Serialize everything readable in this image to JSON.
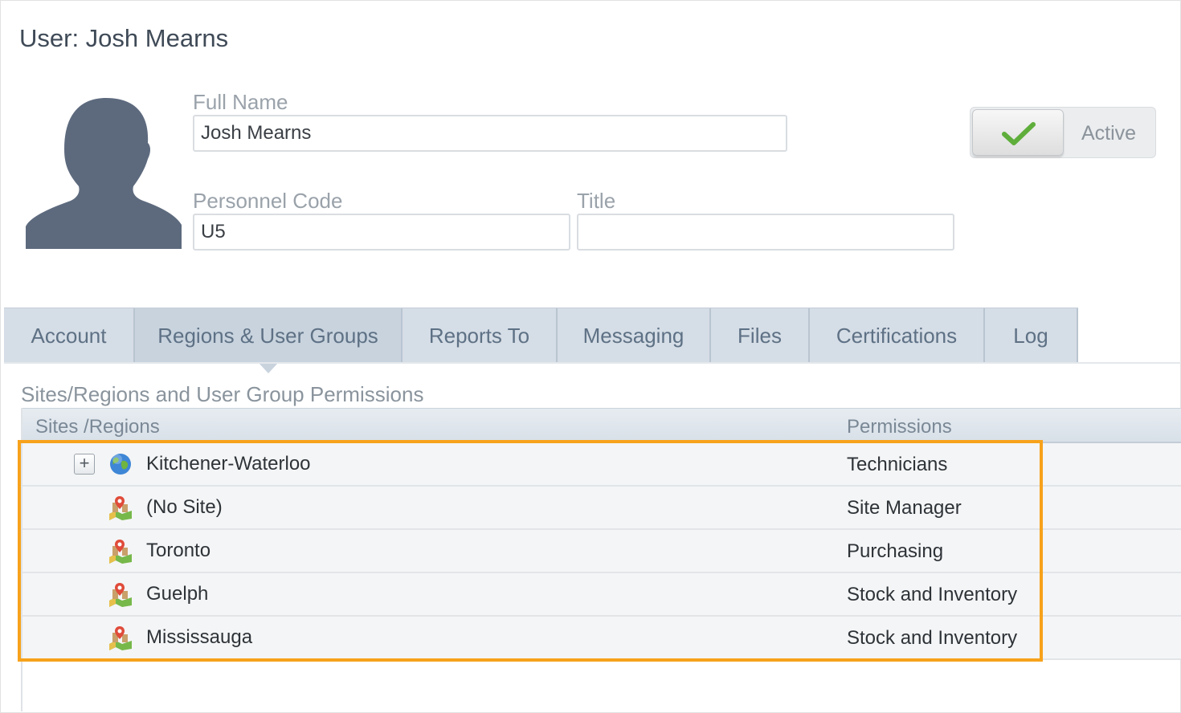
{
  "page": {
    "title": "User: Josh Mearns"
  },
  "form": {
    "full_name_label": "Full Name",
    "full_name_value": "Josh Mearns",
    "personnel_code_label": "Personnel Code",
    "personnel_code_value": "U5",
    "title_label": "Title",
    "title_value": ""
  },
  "status": {
    "active_label": "Active",
    "active": true
  },
  "tabs": [
    {
      "label": "Account"
    },
    {
      "label": "Regions & User Groups",
      "active": true
    },
    {
      "label": "Reports To"
    },
    {
      "label": "Messaging"
    },
    {
      "label": "Files"
    },
    {
      "label": "Certifications"
    },
    {
      "label": "Log"
    }
  ],
  "permissions": {
    "section_title": "Sites/Regions and User Group Permissions",
    "col_sites": "Sites /Regions",
    "col_permissions": "Permissions",
    "rows": [
      {
        "site": "Kitchener-Waterloo",
        "permission": "Technicians",
        "icon": "globe-icon",
        "expandable": true,
        "expander": "+"
      },
      {
        "site": "(No Site)",
        "permission": "Site Manager",
        "icon": "site-map-icon"
      },
      {
        "site": "Toronto",
        "permission": "Purchasing",
        "icon": "site-map-icon"
      },
      {
        "site": "Guelph",
        "permission": "Stock and Inventory",
        "icon": "site-map-icon"
      },
      {
        "site": "Mississauga",
        "permission": "Stock and Inventory",
        "icon": "site-map-icon"
      }
    ]
  },
  "colors": {
    "highlight": "#f7a21b",
    "check": "#5fae3c",
    "tab_bg": "#d5dde6",
    "tab_text": "#5e7185"
  }
}
